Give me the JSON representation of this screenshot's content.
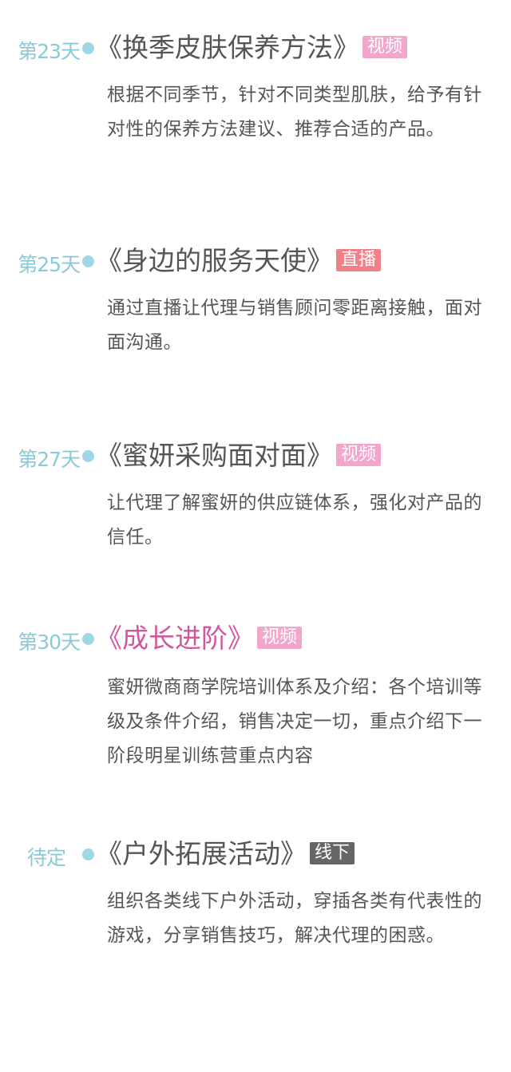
{
  "colors": {
    "day_text": "#8bc9d8",
    "dot": "#9fd7e6",
    "title_text": "#555555",
    "highlight_title": "#d4559e",
    "badge_video": "#f3a6cc",
    "badge_live": "#f07f86",
    "badge_offline": "#666666"
  },
  "entries": [
    {
      "day": "第23天",
      "title": "《换季皮肤保养方法》",
      "badge": "视频",
      "description": "根据不同季节，针对不同类型肌肤，给予有针对性的保养方法建议、推荐合适的产品。"
    },
    {
      "day": "第25天",
      "title": "《身边的服务天使》",
      "badge": "直播",
      "description": "通过直播让代理与销售顾问零距离接触，面对面沟通。"
    },
    {
      "day": "第27天",
      "title": "《蜜妍采购面对面》",
      "badge": "视频",
      "description": "让代理了解蜜妍的供应链体系，强化对产品的信任。"
    },
    {
      "day": "第30天",
      "title": "《成长进阶》",
      "badge": "视频",
      "description": "蜜妍微商商学院培训体系及介绍：各个培训等级及条件介绍，销售决定一切，重点介绍下一阶段明星训练营重点内容"
    },
    {
      "day": "待定",
      "title": "《户外拓展活动》",
      "badge": "线下",
      "description": "组织各类线下户外活动，穿插各类有代表性的游戏，分享销售技巧，解决代理的困惑。"
    }
  ]
}
